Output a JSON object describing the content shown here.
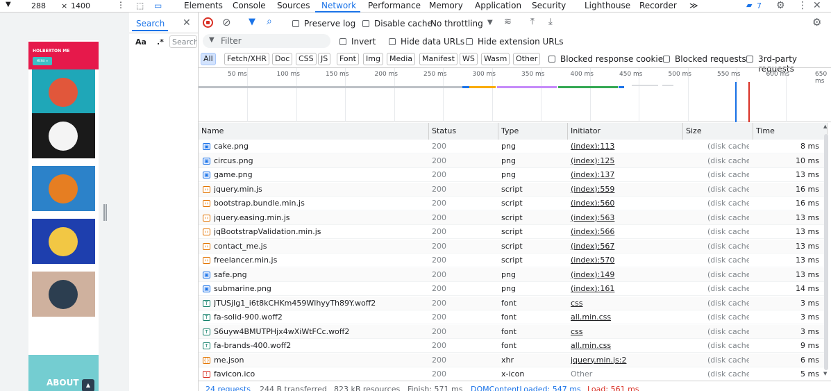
{
  "device": {
    "width": "288",
    "height": "1400",
    "site_title": "HOLBERTON ME",
    "menu_label": "MENU ≡",
    "about_label": "ABOUT",
    "tiles": [
      {
        "name": "cake",
        "bg": "#1fa7b8",
        "circle": "#e1573b"
      },
      {
        "name": "circus",
        "bg": "#1a1a1a",
        "circle": "#f4f4f4"
      },
      {
        "name": "game",
        "bg": "#2c82c9",
        "circle": "#e67e22"
      },
      {
        "name": "safe",
        "bg": "#1e3fae",
        "circle": "#f2c744"
      },
      {
        "name": "submarine",
        "bg": "#cfb19e",
        "circle": "#2c3e50"
      }
    ]
  },
  "tabs": [
    "Elements",
    "Console",
    "Sources",
    "Network",
    "Performance",
    "Memory",
    "Application",
    "Security",
    "Lighthouse",
    "Recorder"
  ],
  "active_tab": "Network",
  "issues_count": "7",
  "search": {
    "title": "Search",
    "aa": "Aa",
    "regex": ".*",
    "placeholder": "Search"
  },
  "toolbar": {
    "preserve_log": "Preserve log",
    "disable_cache": "Disable cache",
    "throttling": "No throttling"
  },
  "filter": {
    "placeholder": "Filter",
    "invert": "Invert",
    "hide_data_urls": "Hide data URLs",
    "hide_ext_urls": "Hide extension URLs"
  },
  "type_filters": [
    "All",
    "Fetch/XHR",
    "Doc",
    "CSS",
    "JS",
    "Font",
    "Img",
    "Media",
    "Manifest",
    "WS",
    "Wasm",
    "Other"
  ],
  "extra_filters": [
    "Blocked response cookies",
    "Blocked requests",
    "3rd-party requests"
  ],
  "timeline_ticks": [
    "50 ms",
    "100 ms",
    "150 ms",
    "200 ms",
    "250 ms",
    "300 ms",
    "350 ms",
    "400 ms",
    "450 ms",
    "500 ms",
    "550 ms",
    "600 ms",
    "650 ms"
  ],
  "columns": [
    "Name",
    "Status",
    "Type",
    "Initiator",
    "Size",
    "Time"
  ],
  "rows": [
    {
      "name": "cake.png",
      "status": "200",
      "type": "png",
      "initiator": "(index):113",
      "size": "(disk cache)",
      "time": "8 ms",
      "icon": "img"
    },
    {
      "name": "circus.png",
      "status": "200",
      "type": "png",
      "initiator": "(index):125",
      "size": "(disk cache)",
      "time": "10 ms",
      "icon": "img"
    },
    {
      "name": "game.png",
      "status": "200",
      "type": "png",
      "initiator": "(index):137",
      "size": "(disk cache)",
      "time": "13 ms",
      "icon": "img"
    },
    {
      "name": "jquery.min.js",
      "status": "200",
      "type": "script",
      "initiator": "(index):559",
      "size": "(disk cache)",
      "time": "16 ms",
      "icon": "js"
    },
    {
      "name": "bootstrap.bundle.min.js",
      "status": "200",
      "type": "script",
      "initiator": "(index):560",
      "size": "(disk cache)",
      "time": "16 ms",
      "icon": "js"
    },
    {
      "name": "jquery.easing.min.js",
      "status": "200",
      "type": "script",
      "initiator": "(index):563",
      "size": "(disk cache)",
      "time": "13 ms",
      "icon": "js"
    },
    {
      "name": "jqBootstrapValidation.min.js",
      "status": "200",
      "type": "script",
      "initiator": "(index):566",
      "size": "(disk cache)",
      "time": "13 ms",
      "icon": "js"
    },
    {
      "name": "contact_me.js",
      "status": "200",
      "type": "script",
      "initiator": "(index):567",
      "size": "(disk cache)",
      "time": "13 ms",
      "icon": "js"
    },
    {
      "name": "freelancer.min.js",
      "status": "200",
      "type": "script",
      "initiator": "(index):570",
      "size": "(disk cache)",
      "time": "13 ms",
      "icon": "js"
    },
    {
      "name": "safe.png",
      "status": "200",
      "type": "png",
      "initiator": "(index):149",
      "size": "(disk cache)",
      "time": "13 ms",
      "icon": "img"
    },
    {
      "name": "submarine.png",
      "status": "200",
      "type": "png",
      "initiator": "(index):161",
      "size": "(disk cache)",
      "time": "14 ms",
      "icon": "img"
    },
    {
      "name": "JTUSjIg1_i6t8kCHKm459WlhyyTh89Y.woff2",
      "status": "200",
      "type": "font",
      "initiator": "css",
      "size": "(disk cache)",
      "time": "3 ms",
      "icon": "font"
    },
    {
      "name": "fa-solid-900.woff2",
      "status": "200",
      "type": "font",
      "initiator": "all.min.css",
      "size": "(disk cache)",
      "time": "3 ms",
      "icon": "font"
    },
    {
      "name": "S6uyw4BMUTPHjx4wXiWtFCc.woff2",
      "status": "200",
      "type": "font",
      "initiator": "css",
      "size": "(disk cache)",
      "time": "3 ms",
      "icon": "font"
    },
    {
      "name": "fa-brands-400.woff2",
      "status": "200",
      "type": "font",
      "initiator": "all.min.css",
      "size": "(disk cache)",
      "time": "9 ms",
      "icon": "font"
    },
    {
      "name": "me.json",
      "status": "200",
      "type": "xhr",
      "initiator": "jquery.min.js:2",
      "size": "(disk cache)",
      "time": "6 ms",
      "icon": "json"
    },
    {
      "name": "favicon.ico",
      "status": "200",
      "type": "x-icon",
      "initiator": "Other",
      "size": "(disk cache)",
      "time": "5 ms",
      "icon": "ico"
    }
  ],
  "status": {
    "requests": "24 requests",
    "transferred": "244 B transferred",
    "resources": "823 kB resources",
    "finish": "Finish: 571 ms",
    "dcl": "DOMContentLoaded: 547 ms",
    "load": "Load: 561 ms"
  },
  "colors": {
    "accent": "#1a73e8",
    "record": "#d93025",
    "load": "#d93025",
    "dcl": "#1a73e8"
  }
}
